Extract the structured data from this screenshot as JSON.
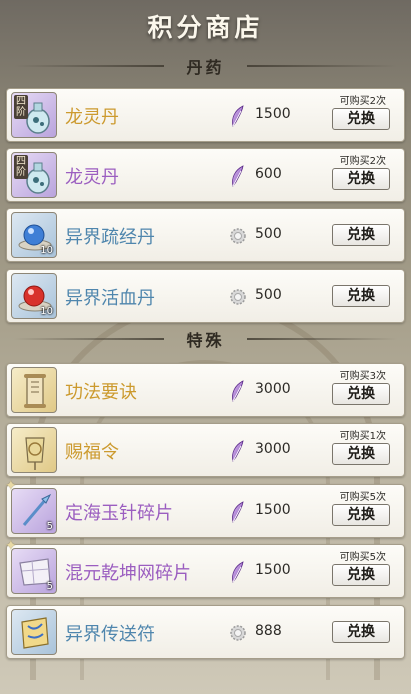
{
  "title": "积分商店",
  "sections": {
    "medicine": "丹药",
    "special": "特殊"
  },
  "items": [
    {
      "name": "龙灵丹",
      "tier": "四阶",
      "price": "1500",
      "limit": "可购买2次",
      "button": "兑换",
      "icon": "purple-potion-icon",
      "currency": "purple-feather-icon"
    },
    {
      "name": "龙灵丹",
      "tier": "四阶",
      "price": "600",
      "limit": "可购买2次",
      "button": "兑换",
      "icon": "purple-potion-icon",
      "currency": "purple-feather-icon"
    },
    {
      "name": "异界疏经丹",
      "count": "10",
      "price": "500",
      "limit": "",
      "button": "兑换",
      "icon": "blue-pill-icon",
      "currency": "silver-gear-icon"
    },
    {
      "name": "异界活血丹",
      "count": "10",
      "price": "500",
      "limit": "",
      "button": "兑换",
      "icon": "red-pill-icon",
      "currency": "silver-gear-icon"
    },
    {
      "name": "功法要诀",
      "price": "3000",
      "limit": "可购买3次",
      "button": "兑换",
      "icon": "scroll-icon",
      "currency": "purple-feather-icon"
    },
    {
      "name": "赐福令",
      "price": "3000",
      "limit": "可购买1次",
      "button": "兑换",
      "icon": "token-icon",
      "currency": "purple-feather-icon"
    },
    {
      "name": "定海玉针碎片",
      "count": "5",
      "price": "1500",
      "limit": "可购买5次",
      "button": "兑换",
      "icon": "needle-fragment-icon",
      "currency": "purple-feather-icon"
    },
    {
      "name": "混元乾坤网碎片",
      "count": "5",
      "price": "1500",
      "limit": "可购买5次",
      "button": "兑换",
      "icon": "net-fragment-icon",
      "currency": "purple-feather-icon"
    },
    {
      "name": "异界传送符",
      "price": "888",
      "limit": "",
      "button": "兑换",
      "icon": "talisman-icon",
      "currency": "silver-gear-icon"
    }
  ],
  "colors": {
    "gold": "#cc9a2e",
    "purple": "#9b5ec0",
    "blue": "#4f86ad"
  }
}
